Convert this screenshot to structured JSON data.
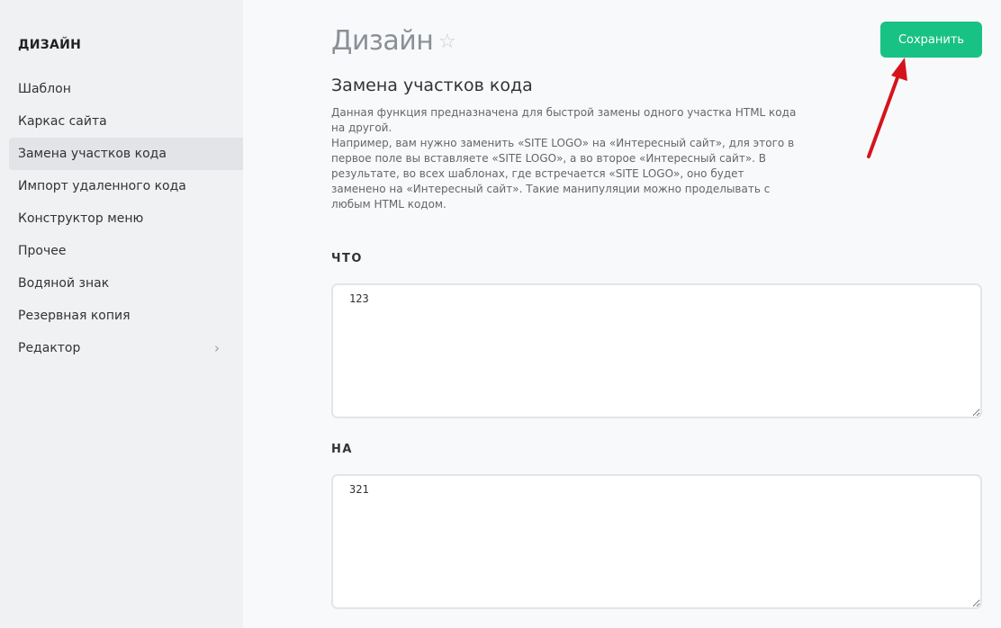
{
  "sidebar": {
    "heading": "ДИЗАЙН",
    "items": [
      {
        "label": "Шаблон"
      },
      {
        "label": "Каркас сайта"
      },
      {
        "label": "Замена участков кода"
      },
      {
        "label": "Импорт удаленного кода"
      },
      {
        "label": "Конструктор меню"
      },
      {
        "label": "Прочее"
      },
      {
        "label": "Водяной знак"
      },
      {
        "label": "Резервная копия"
      },
      {
        "label": "Редактор"
      }
    ],
    "active_index": 2,
    "expandable_icon": "chevron-right-icon"
  },
  "header": {
    "title": "Дизайн",
    "favorite_icon": "star-icon",
    "save_label": "Сохранить"
  },
  "content": {
    "section_title": "Замена участков кода",
    "description": [
      "Данная функция предназначена для быстрой замены одного участка HTML кода на другой.",
      "Например, вам нужно заменить «SITE LOGO» на «Интересный сайт», для этого в первое поле вы вставляете «SITE LOGO», а во второе «Интересный сайт». В результате, во всех шаблонах, где встречается «SITE LOGO», оно будет заменено на «Интересный сайт». Такие манипуляции можно проделывать с любым HTML кодом."
    ],
    "fields": [
      {
        "label": "ЧТО",
        "value": "123"
      },
      {
        "label": "НА",
        "value": "321"
      }
    ]
  },
  "colors": {
    "accent": "#18c284",
    "arrow": "#d4141c",
    "sidebar_bg": "#f0f1f3",
    "sidebar_active": "#e3e4e7"
  }
}
